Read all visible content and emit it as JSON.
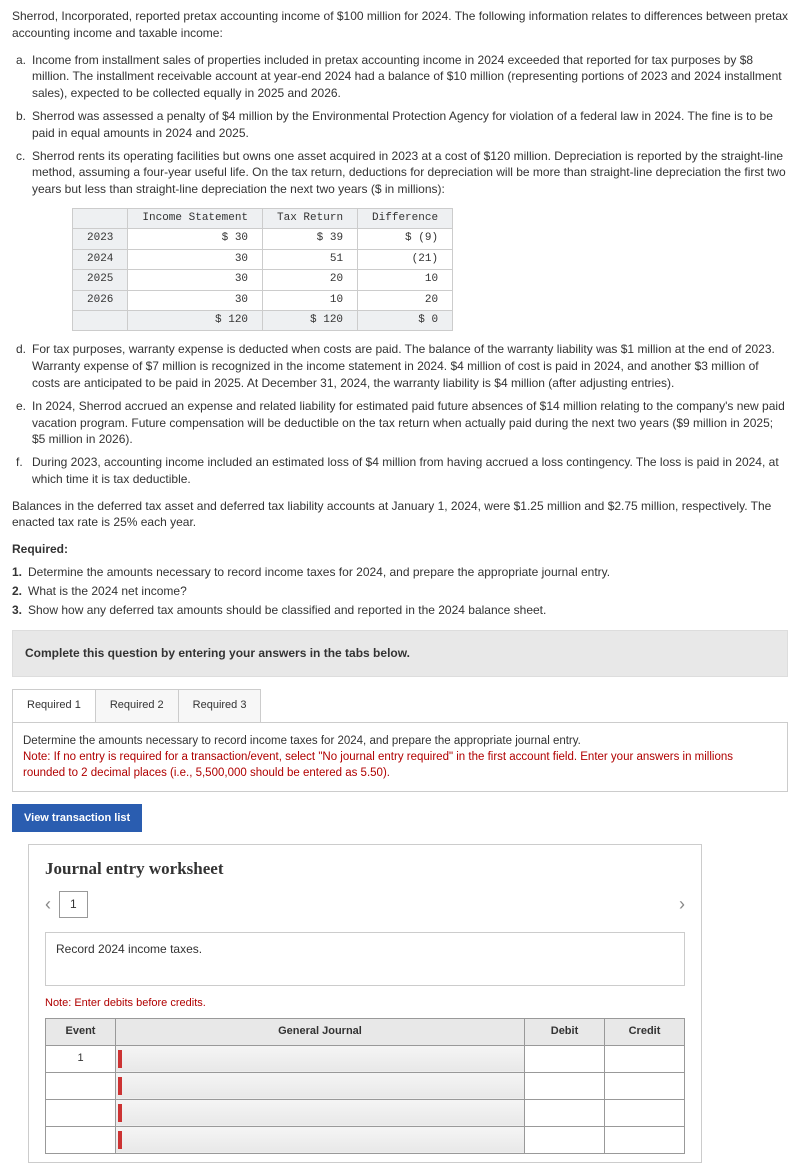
{
  "intro": "Sherrod, Incorporated, reported pretax accounting income of $100 million for 2024. The following information relates to differences between pretax accounting income and taxable income:",
  "items": {
    "a": "Income from installment sales of properties included in pretax accounting income in 2024 exceeded that reported for tax purposes by $8 million. The installment receivable account at year-end 2024 had a balance of $10 million (representing portions of 2023 and 2024 installment sales), expected to be collected equally in 2025 and 2026.",
    "b": "Sherrod was assessed a penalty of $4 million by the Environmental Protection Agency for violation of a federal law in 2024. The fine is to be paid in equal amounts in 2024 and 2025.",
    "c": "Sherrod rents its operating facilities but owns one asset acquired in 2023 at a cost of $120 million. Depreciation is reported by the straight-line method, assuming a four-year useful life. On the tax return, deductions for depreciation will be more than straight-line depreciation the first two years but less than straight-line depreciation the next two years ($ in millions):",
    "d": "For tax purposes, warranty expense is deducted when costs are paid. The balance of the warranty liability was $1 million at the end of 2023. Warranty expense of $7 million is recognized in the income statement in 2024. $4 million of cost is paid in 2024, and another $3 million of costs are anticipated to be paid in 2025. At December 31, 2024, the warranty liability is $4 million (after adjusting entries).",
    "e": "In 2024, Sherrod accrued an expense and related liability for estimated paid future absences of $14 million relating to the company's new paid vacation program. Future compensation will be deductible on the tax return when actually paid during the next two years ($9 million in 2025; $5 million in 2026).",
    "f": "During 2023, accounting income included an estimated loss of $4 million from having accrued a loss contingency. The loss is paid in 2024, at which time it is tax deductible."
  },
  "dep_table": {
    "headers": [
      "",
      "Income Statement",
      "Tax Return",
      "Difference"
    ],
    "rows": [
      {
        "year": "2023",
        "is": "$ 30",
        "tr": "$ 39",
        "diff": "$ (9)"
      },
      {
        "year": "2024",
        "is": "30",
        "tr": "51",
        "diff": "(21)"
      },
      {
        "year": "2025",
        "is": "30",
        "tr": "20",
        "diff": "10"
      },
      {
        "year": "2026",
        "is": "30",
        "tr": "10",
        "diff": "20"
      }
    ],
    "total": {
      "year": "",
      "is": "$ 120",
      "tr": "$ 120",
      "diff": "$ 0"
    }
  },
  "balances": "Balances in the deferred tax asset and deferred tax liability accounts at January 1, 2024, were $1.25 million and $2.75 million, respectively. The enacted tax rate is 25% each year.",
  "required_h": "Required:",
  "requirements": [
    "Determine the amounts necessary to record income taxes for 2024, and prepare the appropriate journal entry.",
    "What is the 2024 net income?",
    "Show how any deferred tax amounts should be classified and reported in the 2024 balance sheet."
  ],
  "tabs_instruction": "Complete this question by entering your answers in the tabs below.",
  "tabs": [
    "Required 1",
    "Required 2",
    "Required 3"
  ],
  "panel": {
    "line1": "Determine the amounts necessary to record income taxes for 2024, and prepare the appropriate journal entry.",
    "note": "Note: If no entry is required for a transaction/event, select \"No journal entry required\" in the first account field. Enter your answers in millions rounded to 2 decimal places (i.e., 5,500,000 should be entered as 5.50)."
  },
  "view_btn": "View transaction list",
  "je": {
    "title": "Journal entry worksheet",
    "page": "1",
    "instruction": "Record 2024 income taxes.",
    "note": "Note: Enter debits before credits.",
    "headers": {
      "event": "Event",
      "gj": "General Journal",
      "debit": "Debit",
      "credit": "Credit"
    },
    "first_event": "1"
  }
}
